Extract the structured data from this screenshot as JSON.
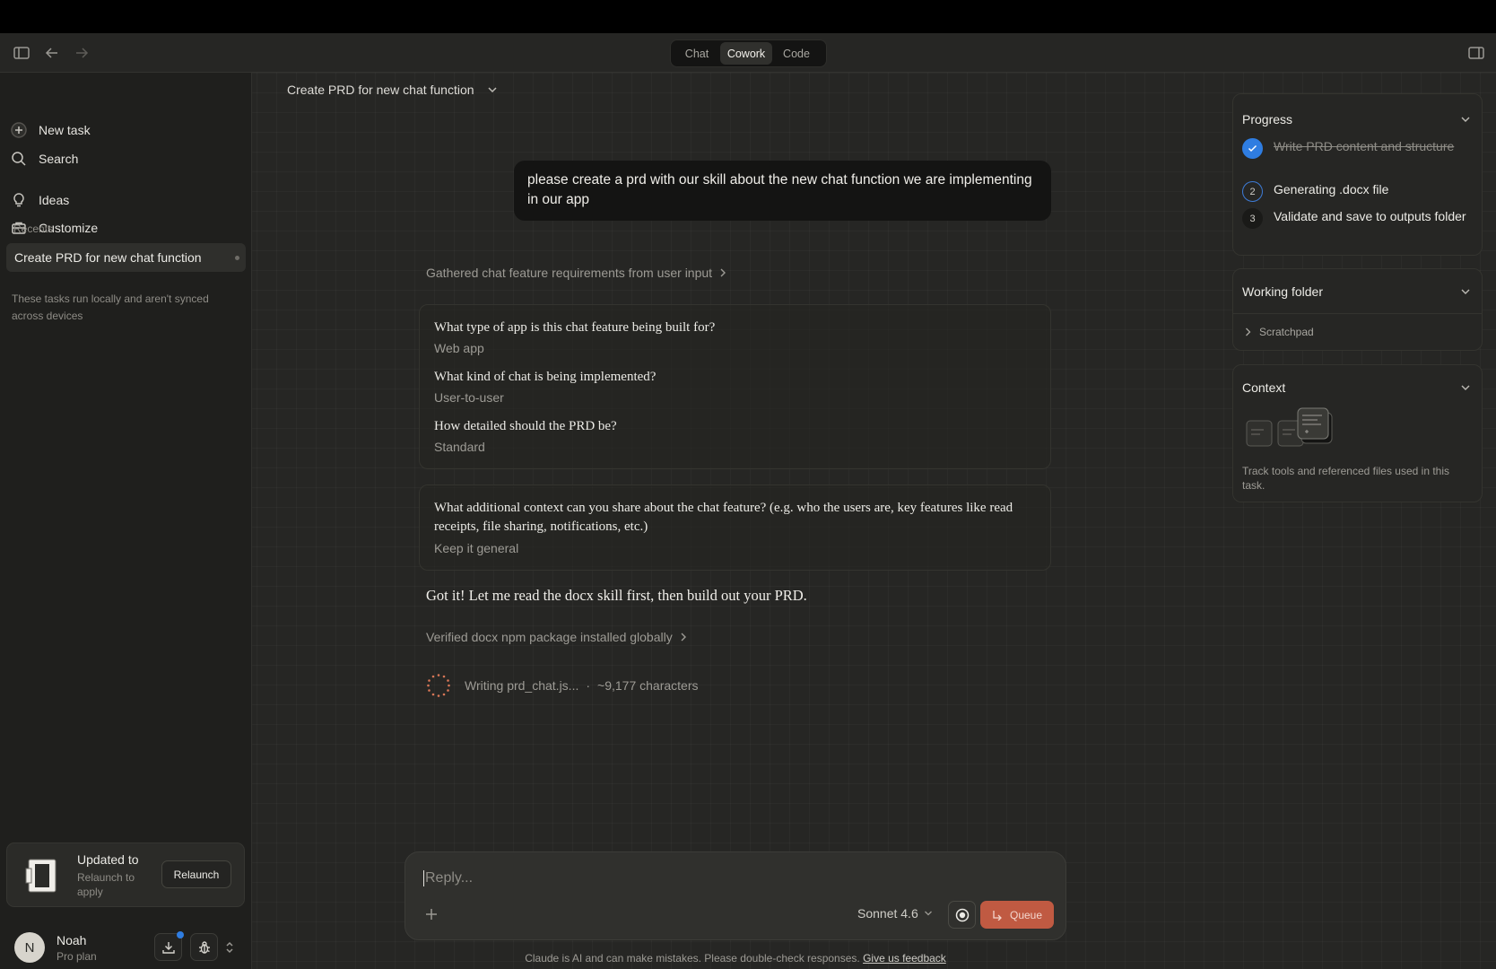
{
  "topbar": {
    "modes": [
      {
        "label": "Chat",
        "active": false
      },
      {
        "label": "Cowork",
        "active": true
      },
      {
        "label": "Code",
        "active": false
      }
    ]
  },
  "sidebar": {
    "new_task": "New task",
    "search": "Search",
    "ideas": "Ideas",
    "customize": "Customize",
    "recents_label": "Recents",
    "recent_item": "Create PRD for new chat function",
    "sync_note": "These tasks run locally and aren't synced across devices",
    "update": {
      "title": "Updated to",
      "subtitle": "Relaunch to apply",
      "button": "Relaunch"
    },
    "user": {
      "initial": "N",
      "name": "Noah",
      "plan": "Pro plan"
    }
  },
  "main": {
    "title": "Create PRD for new chat function",
    "user_message": "please create a prd with our skill about the new chat function we are implementing in our app",
    "step1": "Gathered chat feature requirements from user input",
    "qa": [
      {
        "q": "What type of app is this chat feature being built for?",
        "a": "Web app"
      },
      {
        "q": "What kind of chat is being implemented?",
        "a": "User-to-user"
      },
      {
        "q": "How detailed should the PRD be?",
        "a": "Standard"
      }
    ],
    "qa2": {
      "q": "What additional context can you share about the chat feature? (e.g. who the users are, key features like read receipts, file sharing, notifications, etc.)",
      "a": "Keep it general"
    },
    "assistant_text": "Got it! Let me read the docx skill first, then build out your PRD.",
    "step2": "Verified docx npm package installed globally",
    "writing": {
      "file": "Writing prd_chat.js...",
      "separator": "·",
      "chars": "~9,177 characters"
    }
  },
  "composer": {
    "placeholder": "Reply...",
    "model": "Sonnet 4.6",
    "queue": "Queue",
    "disclaimer": "Claude is AI and can make mistakes. Please double-check responses.",
    "feedback_link": "Give us feedback"
  },
  "right_panel": {
    "progress": {
      "title": "Progress",
      "items": [
        {
          "num": "",
          "text": "Write PRD content and structure",
          "status": "done"
        },
        {
          "num": "2",
          "text": "Generating .docx file",
          "status": "current"
        },
        {
          "num": "3",
          "text": "Validate and save to outputs folder",
          "status": "pending"
        }
      ]
    },
    "working_folder": {
      "title": "Working folder",
      "item": "Scratchpad"
    },
    "context": {
      "title": "Context",
      "description": "Track tools and referenced files used in this task."
    }
  },
  "colors": {
    "accent_blue": "#2f7de1",
    "queue_button": "#c05a42",
    "spinner": "#d97757"
  }
}
